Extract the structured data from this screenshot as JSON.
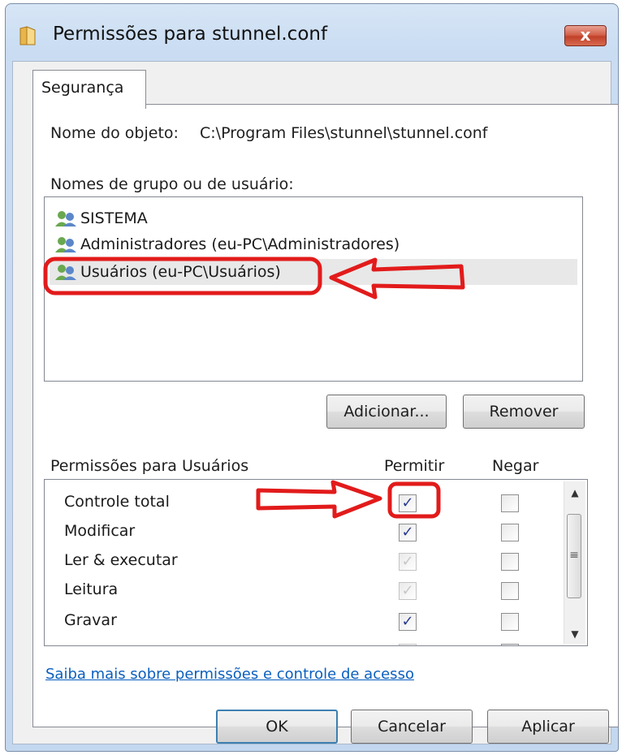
{
  "window": {
    "title": "Permissões para stunnel.conf",
    "close_label": "x"
  },
  "tabs": [
    {
      "label": "Segurança"
    }
  ],
  "object": {
    "label": "Nome do objeto:",
    "value": "C:\\Program Files\\stunnel\\stunnel.conf"
  },
  "groups": {
    "label": "Nomes de grupo ou de usuário:",
    "items": [
      {
        "label": "SISTEMA",
        "selected": false
      },
      {
        "label": "Administradores (eu-PC\\Administradores)",
        "selected": false
      },
      {
        "label": "Usuários (eu-PC\\Usuários)",
        "selected": true
      }
    ]
  },
  "group_buttons": {
    "add": "Adicionar...",
    "remove": "Remover"
  },
  "permissions": {
    "label": "Permissões para Usuários",
    "allow_header": "Permitir",
    "deny_header": "Negar",
    "rows": [
      {
        "name": "Controle total",
        "allow": true,
        "allow_disabled": false,
        "deny": false
      },
      {
        "name": "Modificar",
        "allow": true,
        "allow_disabled": false,
        "deny": false
      },
      {
        "name": "Ler & executar",
        "allow": true,
        "allow_disabled": true,
        "deny": false
      },
      {
        "name": "Leitura",
        "allow": true,
        "allow_disabled": true,
        "deny": false
      },
      {
        "name": "Gravar",
        "allow": true,
        "allow_disabled": false,
        "deny": false
      }
    ]
  },
  "link": "Saiba mais sobre permissões e controle de acesso",
  "footer": {
    "ok": "OK",
    "cancel": "Cancelar",
    "apply": "Aplicar"
  },
  "icons": {
    "title": "folder-icon",
    "user": "user-group-icon",
    "check": "✓"
  },
  "colors": {
    "annotation": "#e21b1b",
    "link": "#0a5fbf",
    "default_button_border": "#3c7fb1"
  }
}
